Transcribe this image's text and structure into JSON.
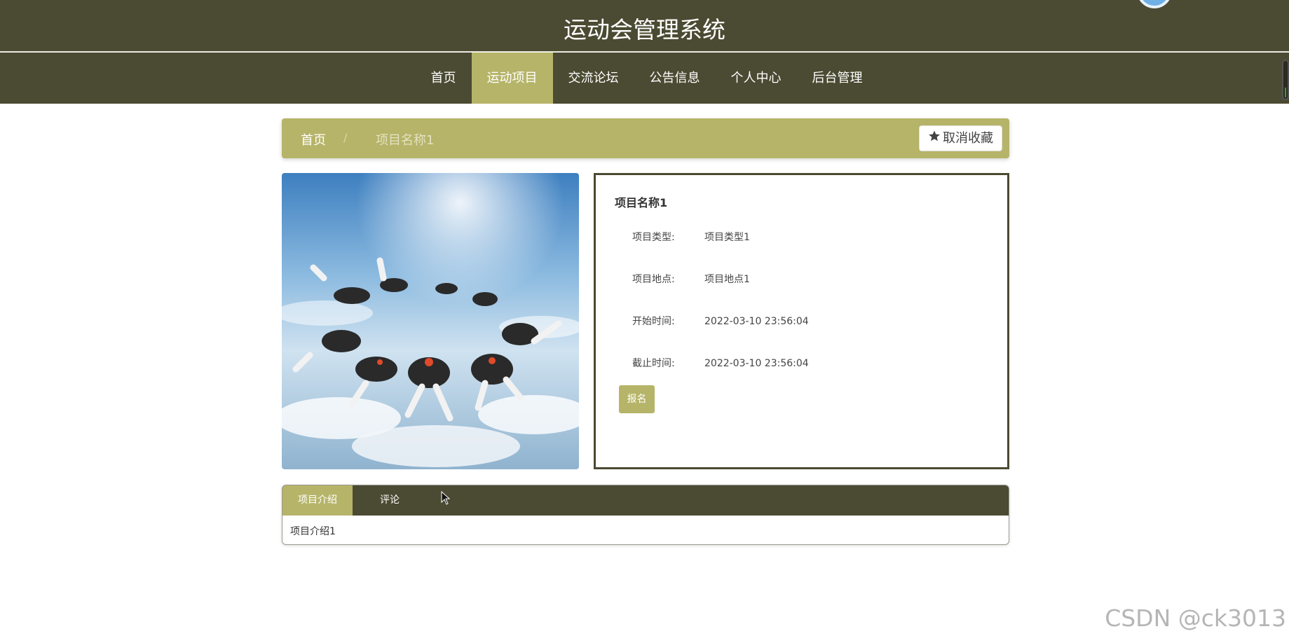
{
  "header": {
    "title": "运动会管理系统"
  },
  "nav": {
    "items": [
      {
        "label": "首页"
      },
      {
        "label": "运动项目"
      },
      {
        "label": "交流论坛"
      },
      {
        "label": "公告信息"
      },
      {
        "label": "个人中心"
      },
      {
        "label": "后台管理"
      }
    ],
    "active_index": 1
  },
  "breadcrumb": {
    "home": "首页",
    "separator": "/",
    "current": "项目名称1"
  },
  "favorite_button": {
    "label": "取消收藏",
    "icon": "star-icon"
  },
  "detail": {
    "title": "项目名称1",
    "fields": [
      {
        "label": "项目类型:",
        "value": "项目类型1"
      },
      {
        "label": "项目地点:",
        "value": "项目地点1"
      },
      {
        "label": "开始时间:",
        "value": "2022-03-10 23:56:04"
      },
      {
        "label": "截止时间:",
        "value": "2022-03-10 23:56:04"
      }
    ],
    "signup_label": "报名"
  },
  "tabs": {
    "items": [
      {
        "label": "项目介绍"
      },
      {
        "label": "评论"
      }
    ],
    "active_index": 0,
    "content": "项目介绍1"
  },
  "watermark": "CSDN @ck3013",
  "colors": {
    "header_bg": "#4b4a32",
    "accent": "#b6b468"
  }
}
